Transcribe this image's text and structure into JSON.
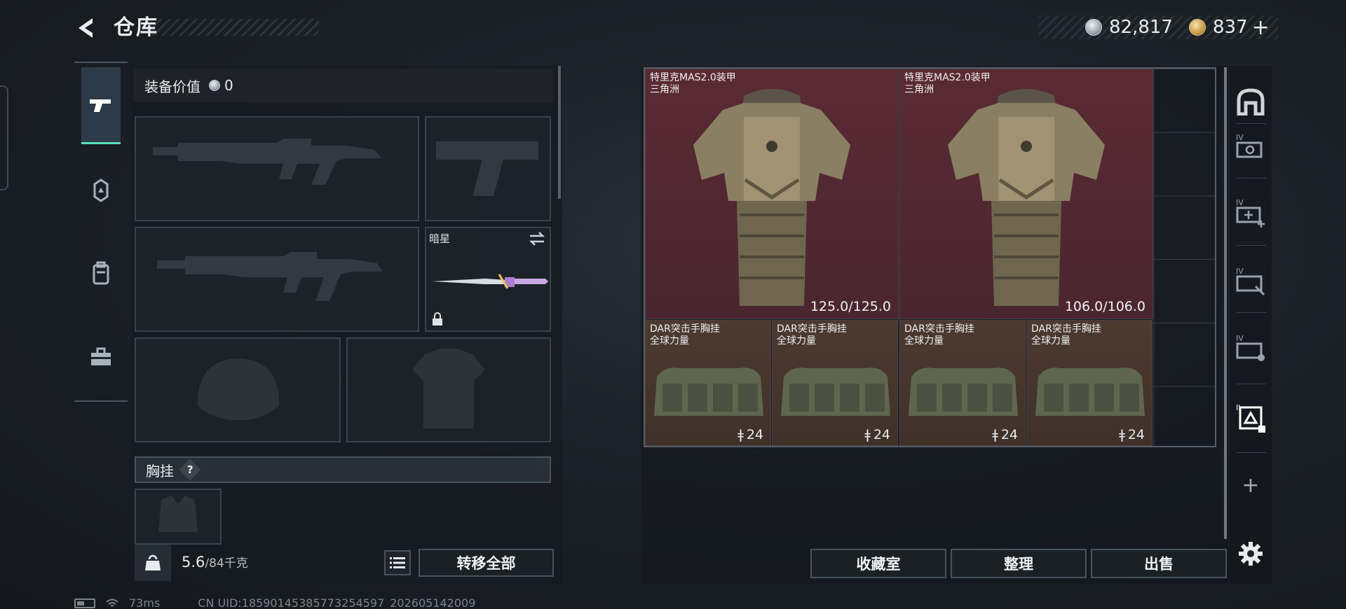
{
  "header": {
    "title": "仓库",
    "currencies": [
      {
        "name": "silver-coin",
        "value": "82,817"
      },
      {
        "name": "gold-token",
        "value": "837",
        "suffix": "+"
      }
    ]
  },
  "loadout": {
    "equip_value_label": "装备价值",
    "equip_value": "0",
    "melee_slot_name": "暗星",
    "chest_rig_label": "胸挂",
    "help": "?",
    "weight_current": "5.6",
    "weight_max": "/84千克",
    "transfer_all": "转移全部"
  },
  "storage": {
    "items": [
      {
        "type": "armor",
        "name": "特里克MAS2.0装甲",
        "sub": "三角洲",
        "durability": "125.0/125.0"
      },
      {
        "type": "armor",
        "name": "特里克MAS2.0装甲",
        "sub": "三角洲",
        "durability": "106.0/106.0"
      },
      {
        "type": "rig",
        "name": "DAR突击手胸挂",
        "sub": "全球力量",
        "capacity": "24"
      },
      {
        "type": "rig",
        "name": "DAR突击手胸挂",
        "sub": "全球力量",
        "capacity": "24"
      },
      {
        "type": "rig",
        "name": "DAR突击手胸挂",
        "sub": "全球力量",
        "capacity": "24"
      },
      {
        "type": "rig",
        "name": "DAR突击手胸挂",
        "sub": "全球力量",
        "capacity": "24"
      }
    ],
    "buttons": {
      "collection": "收藏室",
      "sort": "整理",
      "sell": "出售"
    },
    "side_plus": "+"
  },
  "footer": {
    "ping": "73ms",
    "uid": "CN UID:18590145385773254597_202605142009"
  },
  "colors": {
    "accent": "#58e0b8",
    "armor_bg": "#5a2a33",
    "rig_bg": "#4c3a30"
  }
}
